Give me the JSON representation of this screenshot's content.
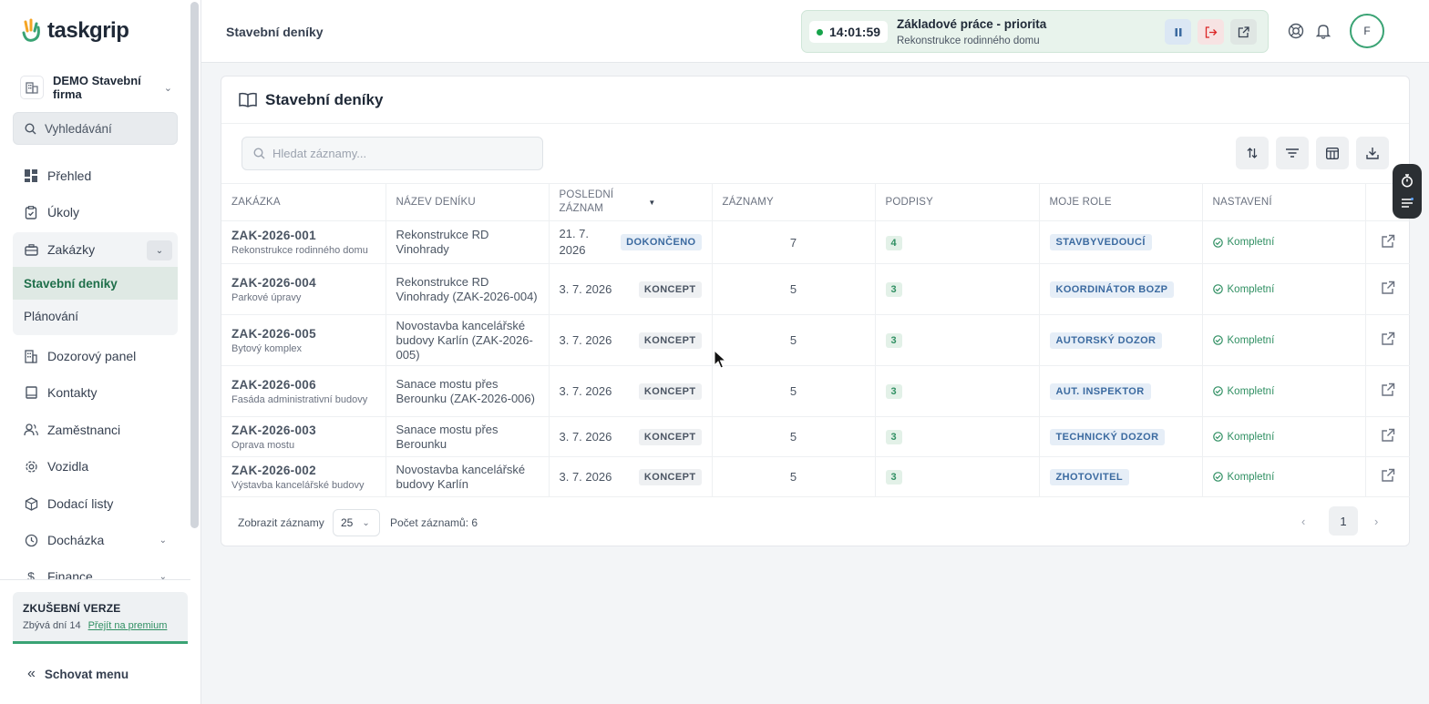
{
  "app": {
    "logo_text": "taskgrip",
    "company": "DEMO Stavební firma",
    "search_placeholder": "Vyhledávání"
  },
  "sidebar": {
    "items": [
      {
        "label": "Přehled",
        "icon": "dashboard-icon"
      },
      {
        "label": "Úkoly",
        "icon": "clipboard-check-icon"
      },
      {
        "label": "Zakázky",
        "icon": "briefcase-icon"
      },
      {
        "label": "Dozorový panel",
        "icon": "building-icon"
      },
      {
        "label": "Kontakty",
        "icon": "contact-book-icon"
      },
      {
        "label": "Zaměstnanci",
        "icon": "users-icon"
      },
      {
        "label": "Vozidla",
        "icon": "gear-icon"
      },
      {
        "label": "Dodací listy",
        "icon": "package-icon"
      },
      {
        "label": "Docházka",
        "icon": "clock-icon"
      },
      {
        "label": "Finance",
        "icon": "dollar-icon"
      }
    ],
    "sub_items": [
      {
        "label": "Stavební deníky",
        "active": true
      },
      {
        "label": "Plánování",
        "active": false
      }
    ],
    "trial": {
      "title": "ZKUŠEBNÍ VERZE",
      "days_left": "Zbývá dní 14",
      "upgrade_link": "Přejít na premium"
    },
    "hide_menu": "Schovat menu"
  },
  "header": {
    "title": "Stavební deníky",
    "timer": {
      "time": "14:01:59",
      "task": "Základové práce - priorita",
      "project": "Rekonstrukce rodinného domu"
    },
    "avatar_initial": "F"
  },
  "card": {
    "title": "Stavební deníky",
    "search_placeholder": "Hledat záznamy...",
    "columns": [
      "Zakázka",
      "Název deníku",
      "Poslední záznam",
      "Záznamy",
      "Podpisy",
      "Moje role",
      "Nastavení"
    ],
    "rows": [
      {
        "code": "ZAK-2026-001",
        "client": "Rekonstrukce rodinného domu",
        "diary": "Rekonstrukce RD Vinohrady",
        "last": "21. 7. 2026",
        "state": "DOKONČENO",
        "done": true,
        "entries": "7",
        "signatures": "4",
        "role": "STAVBYVEDOUCÍ",
        "setting": "Kompletní"
      },
      {
        "code": "ZAK-2026-004",
        "client": "Parkové úpravy",
        "diary": "Rekonstrukce RD Vinohrady (ZAK-2026-004)",
        "last": "3. 7. 2026",
        "state": "KONCEPT",
        "done": false,
        "entries": "5",
        "signatures": "3",
        "role": "KOORDINÁTOR BOZP",
        "setting": "Kompletní"
      },
      {
        "code": "ZAK-2026-005",
        "client": "Bytový komplex",
        "diary": "Novostavba kancelářské budovy Karlín (ZAK-2026-005)",
        "last": "3. 7. 2026",
        "state": "KONCEPT",
        "done": false,
        "entries": "5",
        "signatures": "3",
        "role": "AUTORSKÝ DOZOR",
        "setting": "Kompletní"
      },
      {
        "code": "ZAK-2026-006",
        "client": "Fasáda administrativní budovy",
        "diary": "Sanace mostu přes Berounku (ZAK-2026-006)",
        "last": "3. 7. 2026",
        "state": "KONCEPT",
        "done": false,
        "entries": "5",
        "signatures": "3",
        "role": "AUT. INSPEKTOR",
        "setting": "Kompletní"
      },
      {
        "code": "ZAK-2026-003",
        "client": "Oprava mostu",
        "diary": "Sanace mostu přes Berounku",
        "last": "3. 7. 2026",
        "state": "KONCEPT",
        "done": false,
        "entries": "5",
        "signatures": "3",
        "role": "TECHNICKÝ DOZOR",
        "setting": "Kompletní"
      },
      {
        "code": "ZAK-2026-002",
        "client": "Výstavba kancelářské budovy",
        "diary": "Novostavba kancelářské budovy Karlín",
        "last": "3. 7. 2026",
        "state": "KONCEPT",
        "done": false,
        "entries": "5",
        "signatures": "3",
        "role": "ZHOTOVITEL",
        "setting": "Kompletní"
      }
    ],
    "footer": {
      "show_label": "Zobrazit záznamy",
      "page_size": "25",
      "count": "Počet záznamů: 6",
      "page": "1"
    }
  },
  "colors": {
    "accent": "#3aa374",
    "role_badge": "#3b6aa0"
  }
}
